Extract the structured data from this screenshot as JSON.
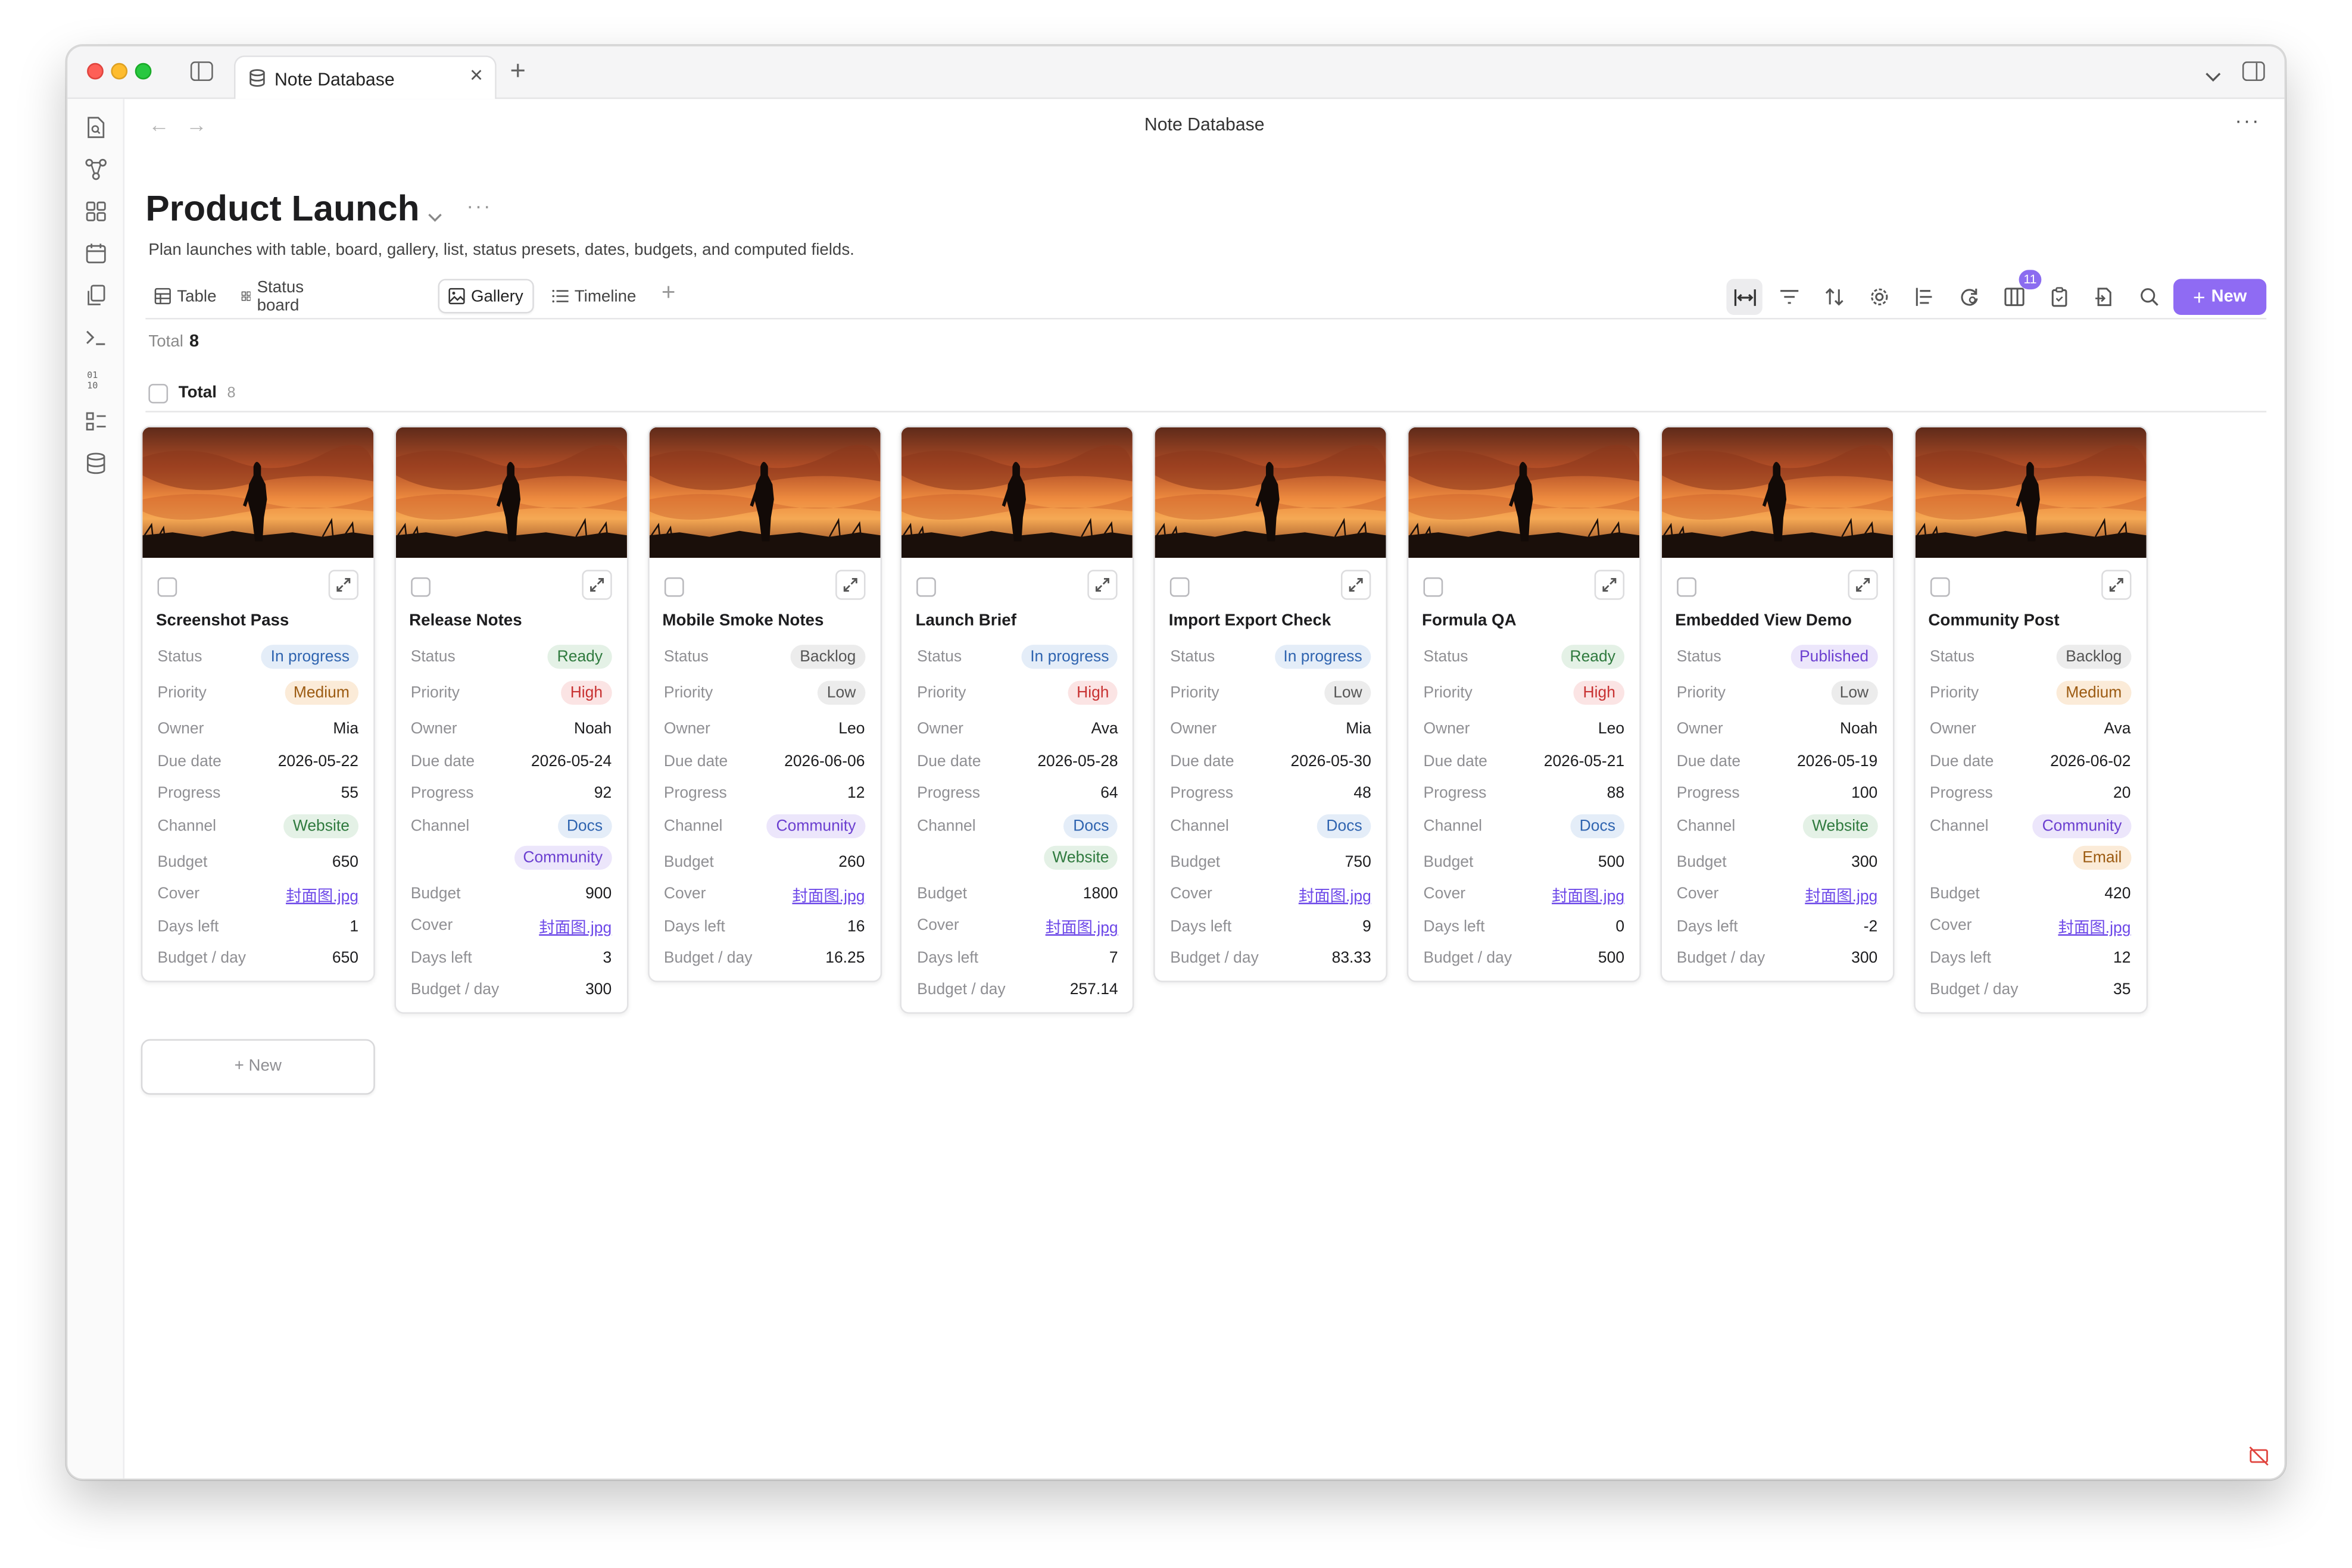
{
  "window": {
    "tab_title": "Note Database",
    "view_header_title": "Note Database"
  },
  "page": {
    "title": "Product Launch",
    "description": "Plan launches with table, board, gallery, list, status presets, dates, budgets, and computed fields."
  },
  "views": [
    {
      "label": "Table",
      "icon": "table-icon"
    },
    {
      "label": "Status board",
      "icon": "board-icon"
    },
    {
      "label": "Gallery",
      "icon": "gallery-icon",
      "active": true
    },
    {
      "label": "Timeline",
      "icon": "list-icon"
    }
  ],
  "toolbar": {
    "fields_badge": "11",
    "new_label": "New"
  },
  "summary": {
    "total_label": "Total",
    "total_value": "8"
  },
  "group": {
    "label": "Total",
    "count": "8"
  },
  "colors": {
    "accent": "#8f6bf3",
    "link": "#6c47e8"
  },
  "labels": {
    "status": "Status",
    "priority": "Priority",
    "owner": "Owner",
    "due_date": "Due date",
    "progress": "Progress",
    "channel": "Channel",
    "budget": "Budget",
    "cover": "Cover",
    "days_left": "Days left",
    "budget_per_day": "Budget / day"
  },
  "cards": [
    {
      "title": "Screenshot Pass",
      "status": "In progress",
      "priority": "Medium",
      "owner": "Mia",
      "due_date": "2026-05-22",
      "progress": "55",
      "channels": [
        "Website"
      ],
      "budget": "650",
      "cover": "封面图.jpg",
      "days_left": "1",
      "budget_per_day": "650"
    },
    {
      "title": "Release Notes",
      "status": "Ready",
      "priority": "High",
      "owner": "Noah",
      "due_date": "2026-05-24",
      "progress": "92",
      "channels": [
        "Docs",
        "Community"
      ],
      "budget": "900",
      "cover": "封面图.jpg",
      "days_left": "3",
      "budget_per_day": "300"
    },
    {
      "title": "Mobile Smoke Notes",
      "status": "Backlog",
      "priority": "Low",
      "owner": "Leo",
      "due_date": "2026-06-06",
      "progress": "12",
      "channels": [
        "Community"
      ],
      "budget": "260",
      "cover": "封面图.jpg",
      "days_left": "16",
      "budget_per_day": "16.25"
    },
    {
      "title": "Launch Brief",
      "status": "In progress",
      "priority": "High",
      "owner": "Ava",
      "due_date": "2026-05-28",
      "progress": "64",
      "channels": [
        "Docs",
        "Website"
      ],
      "budget": "1800",
      "cover": "封面图.jpg",
      "days_left": "7",
      "budget_per_day": "257.14"
    },
    {
      "title": "Import Export Check",
      "status": "In progress",
      "priority": "Low",
      "owner": "Mia",
      "due_date": "2026-05-30",
      "progress": "48",
      "channels": [
        "Docs"
      ],
      "budget": "750",
      "cover": "封面图.jpg",
      "days_left": "9",
      "budget_per_day": "83.33"
    },
    {
      "title": "Formula QA",
      "status": "Ready",
      "priority": "High",
      "owner": "Leo",
      "due_date": "2026-05-21",
      "progress": "88",
      "channels": [
        "Docs"
      ],
      "budget": "500",
      "cover": "封面图.jpg",
      "days_left": "0",
      "budget_per_day": "500"
    },
    {
      "title": "Embedded View Demo",
      "status": "Published",
      "priority": "Low",
      "owner": "Noah",
      "due_date": "2026-05-19",
      "progress": "100",
      "channels": [
        "Website"
      ],
      "budget": "300",
      "cover": "封面图.jpg",
      "days_left": "-2",
      "budget_per_day": "300"
    },
    {
      "title": "Community Post",
      "status": "Backlog",
      "priority": "Medium",
      "owner": "Ava",
      "due_date": "2026-06-02",
      "progress": "20",
      "channels": [
        "Community",
        "Email"
      ],
      "budget": "420",
      "cover": "封面图.jpg",
      "days_left": "12",
      "budget_per_day": "35"
    }
  ],
  "new_card_label": "+ New"
}
